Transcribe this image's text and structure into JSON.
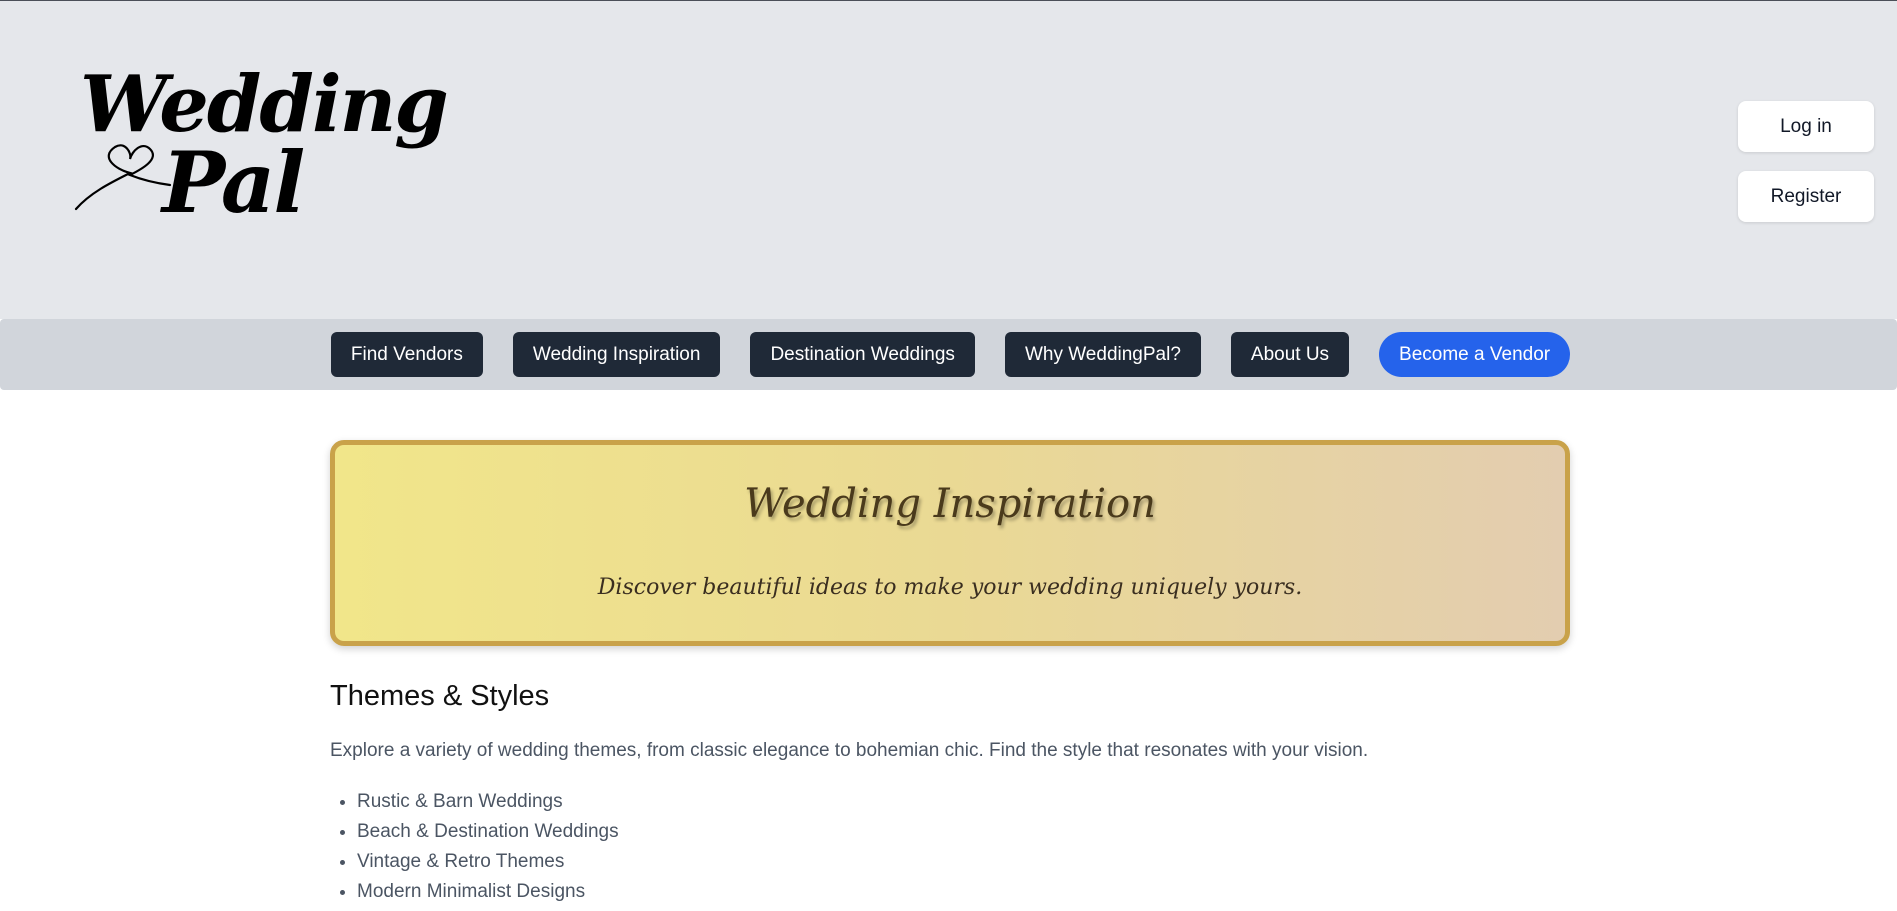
{
  "brand": {
    "logo_line1": "Wedding",
    "logo_line2": "Pal"
  },
  "auth": {
    "login_label": "Log in",
    "register_label": "Register"
  },
  "nav": {
    "items": [
      {
        "label": "Find Vendors"
      },
      {
        "label": "Wedding Inspiration"
      },
      {
        "label": "Destination Weddings"
      },
      {
        "label": "Why WeddingPal?"
      },
      {
        "label": "About Us"
      },
      {
        "label": "Become a Vendor"
      }
    ]
  },
  "hero": {
    "title": "Wedding Inspiration",
    "subtitle": "Discover beautiful ideas to make your wedding uniquely yours."
  },
  "themes": {
    "heading": "Themes & Styles",
    "description": "Explore a variety of wedding themes, from classic elegance to bohemian chic. Find the style that resonates with your vision.",
    "items": [
      "Rustic & Barn Weddings",
      "Beach & Destination Weddings",
      "Vintage & Retro Themes",
      "Modern Minimalist Designs"
    ]
  },
  "colors": {
    "header_bg": "#e5e7eb",
    "navbar_bg": "#d1d5db",
    "nav_button": "#1f2937",
    "accent_button": "#2563eb",
    "hero_border": "#c9a24a"
  }
}
